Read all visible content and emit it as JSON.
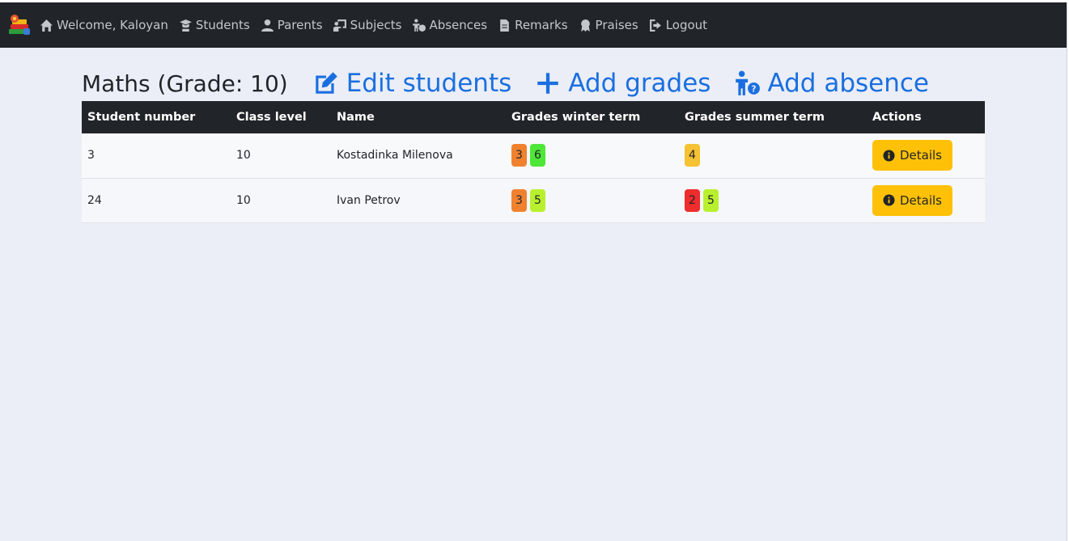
{
  "navbar": {
    "items": [
      {
        "icon": "home-icon",
        "label": "Welcome, Kaloyan"
      },
      {
        "icon": "graduation-cap-icon",
        "label": "Students"
      },
      {
        "icon": "user-icon",
        "label": "Parents"
      },
      {
        "icon": "chalkboard-teacher-icon",
        "label": "Subjects"
      },
      {
        "icon": "person-question-icon",
        "label": "Absences"
      },
      {
        "icon": "file-icon",
        "label": "Remarks"
      },
      {
        "icon": "award-icon",
        "label": "Praises"
      },
      {
        "icon": "logout-icon",
        "label": "Logout"
      }
    ]
  },
  "page": {
    "title": "Maths (Grade: 10)",
    "edit_students": "Edit students",
    "add_grades": "Add grades",
    "add_absence": "Add absence"
  },
  "table": {
    "headers": [
      "Student number",
      "Class level",
      "Name",
      "Grades winter term",
      "Grades summer term",
      "Actions"
    ],
    "rows": [
      {
        "number": "3",
        "class_level": "10",
        "name": "Kostadinka Milenova",
        "winter": [
          {
            "value": "3",
            "color": "#f0822f"
          },
          {
            "value": "6",
            "color": "#4ee637"
          }
        ],
        "summer": [
          {
            "value": "4",
            "color": "#f4c232"
          }
        ],
        "action": "Details"
      },
      {
        "number": "24",
        "class_level": "10",
        "name": "Ivan Petrov",
        "winter": [
          {
            "value": "3",
            "color": "#f0822f"
          },
          {
            "value": "5",
            "color": "#b8f02e"
          }
        ],
        "summer": [
          {
            "value": "2",
            "color": "#ee2d2d"
          },
          {
            "value": "5",
            "color": "#b8f02e"
          }
        ],
        "action": "Details"
      }
    ]
  }
}
